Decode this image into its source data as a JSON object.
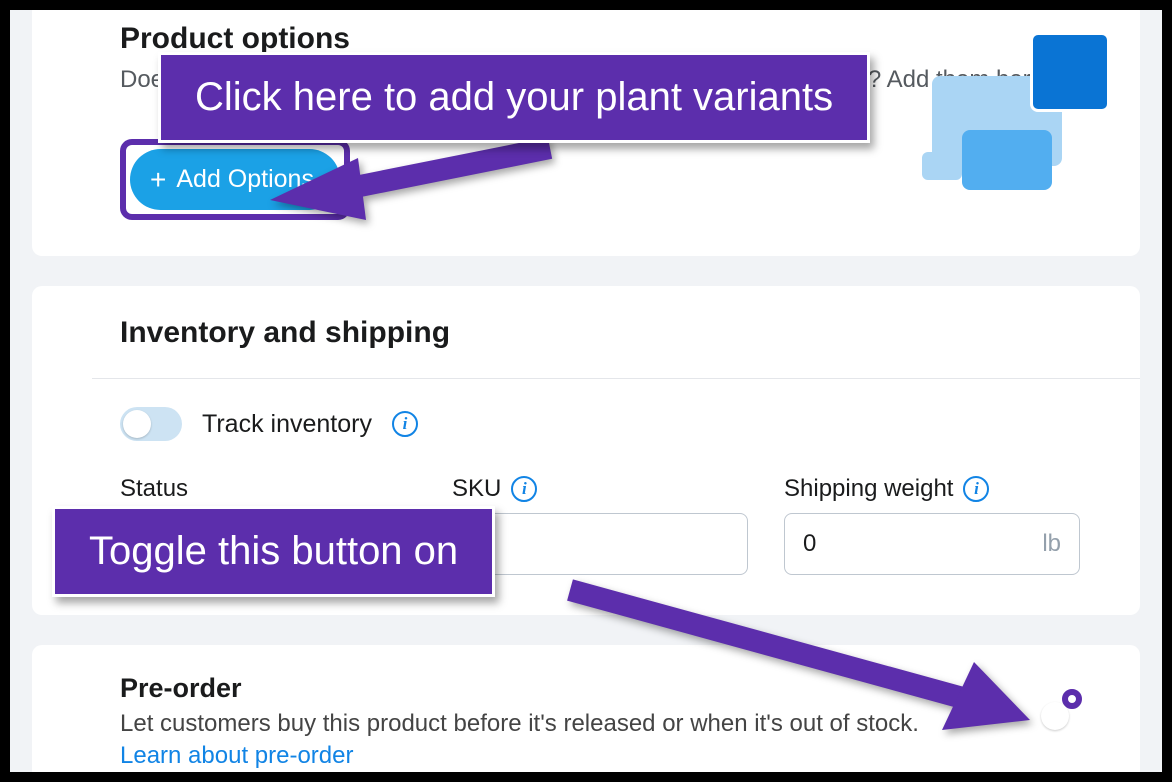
{
  "options": {
    "title": "Product options",
    "description": "Does your product come in different options, like size, color or material? Add them here.",
    "button_label": "Add Options"
  },
  "inventory": {
    "title": "Inventory and shipping",
    "track_label": "Track inventory",
    "status_label": "Status",
    "sku_label": "SKU",
    "weight_label": "Shipping weight",
    "weight_value": "0",
    "weight_unit": "lb"
  },
  "preorder": {
    "title": "Pre-order",
    "description": "Let customers buy this product before it's released or when it's out of stock.",
    "link_text": "Learn about pre-order"
  },
  "callouts": {
    "c1": "Click here to add your plant variants",
    "c2": "Toggle this button on"
  }
}
